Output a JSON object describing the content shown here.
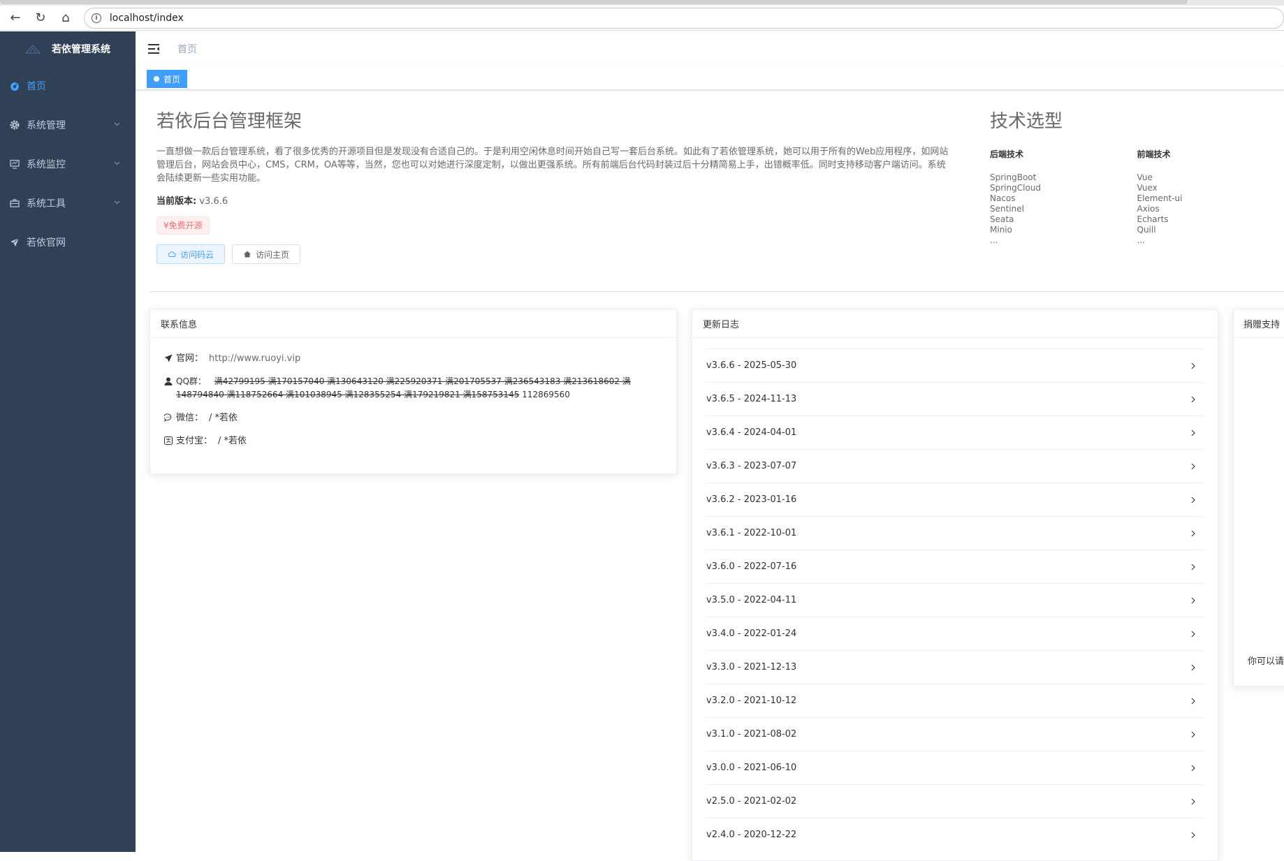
{
  "browser": {
    "url": "localhost/index"
  },
  "sidebar": {
    "logo_text": "若依管理系统",
    "items": [
      {
        "label": "首页",
        "icon": "dashboard-icon",
        "active": true
      },
      {
        "label": "系统管理",
        "icon": "gear-icon"
      },
      {
        "label": "系统监控",
        "icon": "monitor-icon"
      },
      {
        "label": "系统工具",
        "icon": "toolbox-icon"
      },
      {
        "label": "若依官网",
        "icon": "paper-plane-icon"
      }
    ]
  },
  "navbar": {
    "breadcrumb": "首页"
  },
  "tags": {
    "active": "首页"
  },
  "intro": {
    "title": "若依后台管理框架",
    "description": "一直想做一款后台管理系统，看了很多优秀的开源项目但是发现没有合适自己的。于是利用空闲休息时间开始自己写一套后台系统。如此有了若依管理系统，她可以用于所有的Web应用程序，如网站管理后台，网站会员中心，CMS，CRM，OA等等，当然，您也可以对她进行深度定制，以做出更强系统。所有前端后台代码封装过后十分精简易上手，出错概率低。同时支持移动客户端访问。系统会陆续更新一些实用功能。",
    "version_label": "当前版本:",
    "version_value": "v3.6.6",
    "free_tag": "¥免费开源",
    "btn_gitee": "访问码云",
    "btn_home": "访问主页"
  },
  "tech": {
    "title": "技术选型",
    "backend_title": "后端技术",
    "backend": [
      "SpringBoot",
      "SpringCloud",
      "Nacos",
      "Sentinel",
      "Seata",
      "Minio",
      "..."
    ],
    "frontend_title": "前端技术",
    "frontend": [
      "Vue",
      "Vuex",
      "Element-ui",
      "Axios",
      "Echarts",
      "Quill",
      "..."
    ]
  },
  "contact": {
    "title": "联系信息",
    "site_label": "官网：",
    "site_value": "http://www.ruoyi.vip",
    "qq_label": "QQ群：",
    "qq_old": "满42799195 满170157040 满130643120 满225920371 满201705537 满236543183 满213618602 满148794840 满118752664 满101038945 满128355254 满179219821 满158753145",
    "qq_current": "112869560",
    "wechat_label": "微信：",
    "wechat_value": "/ *若依",
    "alipay_label": "支付宝：",
    "alipay_value": "/ *若依"
  },
  "changelog": {
    "title": "更新日志",
    "items": [
      "v3.6.6 - 2025-05-30",
      "v3.6.5 - 2024-11-13",
      "v3.6.4 - 2024-04-01",
      "v3.6.3 - 2023-07-07",
      "v3.6.2 - 2023-01-16",
      "v3.6.1 - 2022-10-01",
      "v3.6.0 - 2022-07-16",
      "v3.5.0 - 2022-04-11",
      "v3.4.0 - 2022-01-24",
      "v3.3.0 - 2021-12-13",
      "v3.2.0 - 2021-10-12",
      "v3.1.0 - 2021-08-02",
      "v3.0.0 - 2021-06-10",
      "v2.5.0 - 2021-02-02",
      "v2.4.0 - 2020-12-22"
    ]
  },
  "donate": {
    "title": "捐赠支持",
    "text": "你可以请"
  },
  "colors": {
    "sidebar_bg": "#304156",
    "accent": "#409eff",
    "danger": "#f56c6c"
  }
}
